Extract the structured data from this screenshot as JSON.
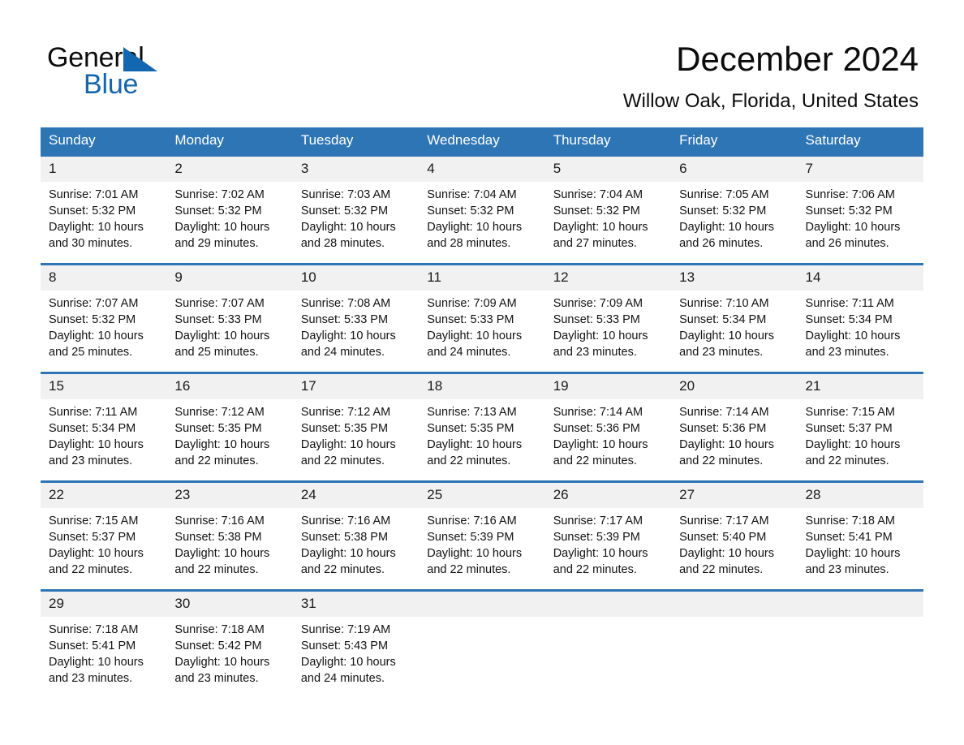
{
  "brand": {
    "word_one": "General",
    "word_two": "Blue",
    "triangle_color": "#1267b0",
    "text_color": "#0c0c0c"
  },
  "header": {
    "title": "December 2024",
    "location": "Willow Oak, Florida, United States"
  },
  "theme": {
    "header_blue": "#2e75b6",
    "row_rule_blue": "#2e75b6",
    "daynum_band": "#f1f1f1",
    "page_background": "#ffffff"
  },
  "weekdays": [
    "Sunday",
    "Monday",
    "Tuesday",
    "Wednesday",
    "Thursday",
    "Friday",
    "Saturday"
  ],
  "weeks": [
    [
      {
        "day": "1",
        "sunrise": "Sunrise: 7:01 AM",
        "sunset": "Sunset: 5:32 PM",
        "daylight_line1": "Daylight: 10 hours",
        "daylight_line2": "and 30 minutes."
      },
      {
        "day": "2",
        "sunrise": "Sunrise: 7:02 AM",
        "sunset": "Sunset: 5:32 PM",
        "daylight_line1": "Daylight: 10 hours",
        "daylight_line2": "and 29 minutes."
      },
      {
        "day": "3",
        "sunrise": "Sunrise: 7:03 AM",
        "sunset": "Sunset: 5:32 PM",
        "daylight_line1": "Daylight: 10 hours",
        "daylight_line2": "and 28 minutes."
      },
      {
        "day": "4",
        "sunrise": "Sunrise: 7:04 AM",
        "sunset": "Sunset: 5:32 PM",
        "daylight_line1": "Daylight: 10 hours",
        "daylight_line2": "and 28 minutes."
      },
      {
        "day": "5",
        "sunrise": "Sunrise: 7:04 AM",
        "sunset": "Sunset: 5:32 PM",
        "daylight_line1": "Daylight: 10 hours",
        "daylight_line2": "and 27 minutes."
      },
      {
        "day": "6",
        "sunrise": "Sunrise: 7:05 AM",
        "sunset": "Sunset: 5:32 PM",
        "daylight_line1": "Daylight: 10 hours",
        "daylight_line2": "and 26 minutes."
      },
      {
        "day": "7",
        "sunrise": "Sunrise: 7:06 AM",
        "sunset": "Sunset: 5:32 PM",
        "daylight_line1": "Daylight: 10 hours",
        "daylight_line2": "and 26 minutes."
      }
    ],
    [
      {
        "day": "8",
        "sunrise": "Sunrise: 7:07 AM",
        "sunset": "Sunset: 5:32 PM",
        "daylight_line1": "Daylight: 10 hours",
        "daylight_line2": "and 25 minutes."
      },
      {
        "day": "9",
        "sunrise": "Sunrise: 7:07 AM",
        "sunset": "Sunset: 5:33 PM",
        "daylight_line1": "Daylight: 10 hours",
        "daylight_line2": "and 25 minutes."
      },
      {
        "day": "10",
        "sunrise": "Sunrise: 7:08 AM",
        "sunset": "Sunset: 5:33 PM",
        "daylight_line1": "Daylight: 10 hours",
        "daylight_line2": "and 24 minutes."
      },
      {
        "day": "11",
        "sunrise": "Sunrise: 7:09 AM",
        "sunset": "Sunset: 5:33 PM",
        "daylight_line1": "Daylight: 10 hours",
        "daylight_line2": "and 24 minutes."
      },
      {
        "day": "12",
        "sunrise": "Sunrise: 7:09 AM",
        "sunset": "Sunset: 5:33 PM",
        "daylight_line1": "Daylight: 10 hours",
        "daylight_line2": "and 23 minutes."
      },
      {
        "day": "13",
        "sunrise": "Sunrise: 7:10 AM",
        "sunset": "Sunset: 5:34 PM",
        "daylight_line1": "Daylight: 10 hours",
        "daylight_line2": "and 23 minutes."
      },
      {
        "day": "14",
        "sunrise": "Sunrise: 7:11 AM",
        "sunset": "Sunset: 5:34 PM",
        "daylight_line1": "Daylight: 10 hours",
        "daylight_line2": "and 23 minutes."
      }
    ],
    [
      {
        "day": "15",
        "sunrise": "Sunrise: 7:11 AM",
        "sunset": "Sunset: 5:34 PM",
        "daylight_line1": "Daylight: 10 hours",
        "daylight_line2": "and 23 minutes."
      },
      {
        "day": "16",
        "sunrise": "Sunrise: 7:12 AM",
        "sunset": "Sunset: 5:35 PM",
        "daylight_line1": "Daylight: 10 hours",
        "daylight_line2": "and 22 minutes."
      },
      {
        "day": "17",
        "sunrise": "Sunrise: 7:12 AM",
        "sunset": "Sunset: 5:35 PM",
        "daylight_line1": "Daylight: 10 hours",
        "daylight_line2": "and 22 minutes."
      },
      {
        "day": "18",
        "sunrise": "Sunrise: 7:13 AM",
        "sunset": "Sunset: 5:35 PM",
        "daylight_line1": "Daylight: 10 hours",
        "daylight_line2": "and 22 minutes."
      },
      {
        "day": "19",
        "sunrise": "Sunrise: 7:14 AM",
        "sunset": "Sunset: 5:36 PM",
        "daylight_line1": "Daylight: 10 hours",
        "daylight_line2": "and 22 minutes."
      },
      {
        "day": "20",
        "sunrise": "Sunrise: 7:14 AM",
        "sunset": "Sunset: 5:36 PM",
        "daylight_line1": "Daylight: 10 hours",
        "daylight_line2": "and 22 minutes."
      },
      {
        "day": "21",
        "sunrise": "Sunrise: 7:15 AM",
        "sunset": "Sunset: 5:37 PM",
        "daylight_line1": "Daylight: 10 hours",
        "daylight_line2": "and 22 minutes."
      }
    ],
    [
      {
        "day": "22",
        "sunrise": "Sunrise: 7:15 AM",
        "sunset": "Sunset: 5:37 PM",
        "daylight_line1": "Daylight: 10 hours",
        "daylight_line2": "and 22 minutes."
      },
      {
        "day": "23",
        "sunrise": "Sunrise: 7:16 AM",
        "sunset": "Sunset: 5:38 PM",
        "daylight_line1": "Daylight: 10 hours",
        "daylight_line2": "and 22 minutes."
      },
      {
        "day": "24",
        "sunrise": "Sunrise: 7:16 AM",
        "sunset": "Sunset: 5:38 PM",
        "daylight_line1": "Daylight: 10 hours",
        "daylight_line2": "and 22 minutes."
      },
      {
        "day": "25",
        "sunrise": "Sunrise: 7:16 AM",
        "sunset": "Sunset: 5:39 PM",
        "daylight_line1": "Daylight: 10 hours",
        "daylight_line2": "and 22 minutes."
      },
      {
        "day": "26",
        "sunrise": "Sunrise: 7:17 AM",
        "sunset": "Sunset: 5:39 PM",
        "daylight_line1": "Daylight: 10 hours",
        "daylight_line2": "and 22 minutes."
      },
      {
        "day": "27",
        "sunrise": "Sunrise: 7:17 AM",
        "sunset": "Sunset: 5:40 PM",
        "daylight_line1": "Daylight: 10 hours",
        "daylight_line2": "and 22 minutes."
      },
      {
        "day": "28",
        "sunrise": "Sunrise: 7:18 AM",
        "sunset": "Sunset: 5:41 PM",
        "daylight_line1": "Daylight: 10 hours",
        "daylight_line2": "and 23 minutes."
      }
    ],
    [
      {
        "day": "29",
        "sunrise": "Sunrise: 7:18 AM",
        "sunset": "Sunset: 5:41 PM",
        "daylight_line1": "Daylight: 10 hours",
        "daylight_line2": "and 23 minutes."
      },
      {
        "day": "30",
        "sunrise": "Sunrise: 7:18 AM",
        "sunset": "Sunset: 5:42 PM",
        "daylight_line1": "Daylight: 10 hours",
        "daylight_line2": "and 23 minutes."
      },
      {
        "day": "31",
        "sunrise": "Sunrise: 7:19 AM",
        "sunset": "Sunset: 5:43 PM",
        "daylight_line1": "Daylight: 10 hours",
        "daylight_line2": "and 24 minutes."
      },
      {
        "day": "",
        "sunrise": "",
        "sunset": "",
        "daylight_line1": "",
        "daylight_line2": ""
      },
      {
        "day": "",
        "sunrise": "",
        "sunset": "",
        "daylight_line1": "",
        "daylight_line2": ""
      },
      {
        "day": "",
        "sunrise": "",
        "sunset": "",
        "daylight_line1": "",
        "daylight_line2": ""
      },
      {
        "day": "",
        "sunrise": "",
        "sunset": "",
        "daylight_line1": "",
        "daylight_line2": ""
      }
    ]
  ]
}
